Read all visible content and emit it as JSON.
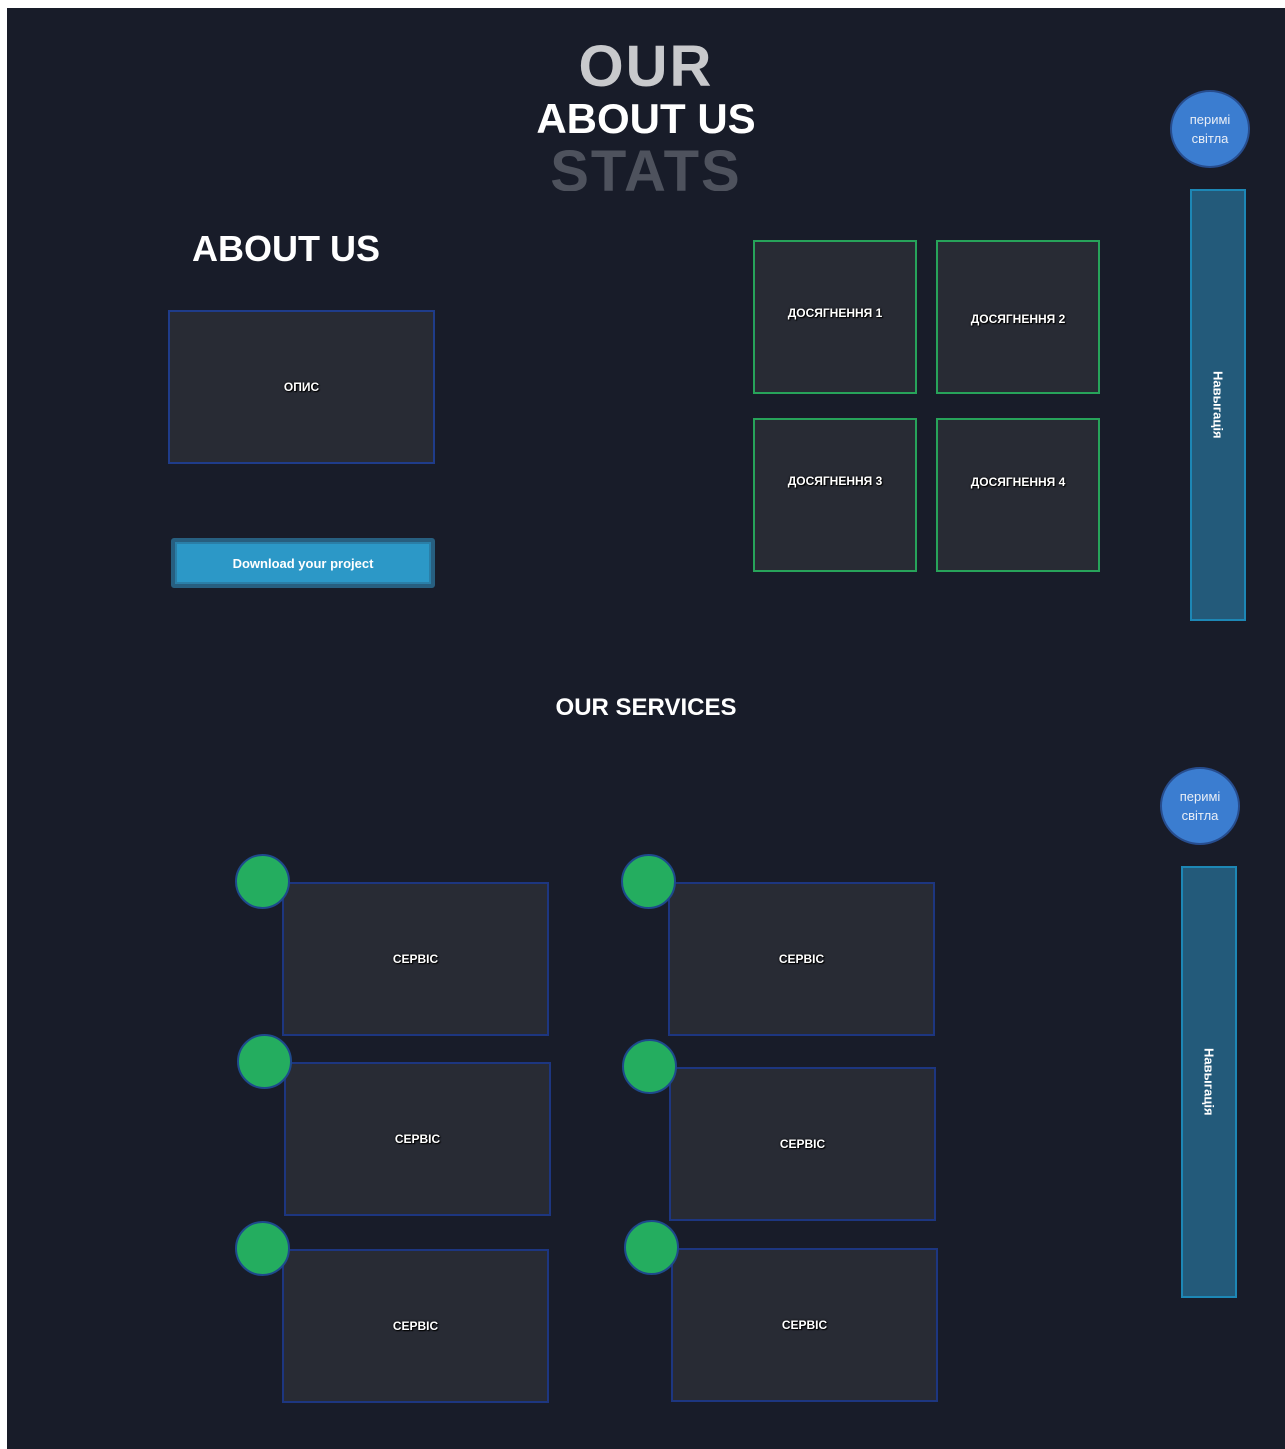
{
  "hero": {
    "bg_top": "OUR",
    "title": "ABOUT US",
    "bg_bottom": "STATS"
  },
  "about": {
    "title": "ABOUT US",
    "description_label": "ОПИС",
    "download_button": "Download your project"
  },
  "achievements": [
    {
      "label": "ДОСЯГНЕННЯ 1"
    },
    {
      "label": "ДОСЯГНЕННЯ  2"
    },
    {
      "label": "ДОСЯГНЕННЯ 3"
    },
    {
      "label": "ДОСЯГНЕННЯ  4"
    }
  ],
  "side_panels": [
    {
      "toggle_line1": "перимі",
      "toggle_line2": "світла",
      "nav_label": "Навыгація"
    },
    {
      "toggle_line1": "перимі",
      "toggle_line2": "світла",
      "nav_label": "Навыгація"
    }
  ],
  "services": {
    "title": "OUR SERVICES",
    "items": [
      {
        "label": "СЕРВІС"
      },
      {
        "label": "СЕРВІС"
      },
      {
        "label": "СЕРВІС"
      },
      {
        "label": "СЕРВІС"
      },
      {
        "label": "СЕРВІС"
      },
      {
        "label": "СЕРВІС"
      }
    ]
  },
  "colors": {
    "background": "#181c29",
    "card": "#282b34",
    "achievement_border": "#27a35a",
    "service_dot": "#24ad5f",
    "button": "#2c98c7",
    "toggle": "#3b7dd0",
    "nav": "#235a7a"
  }
}
